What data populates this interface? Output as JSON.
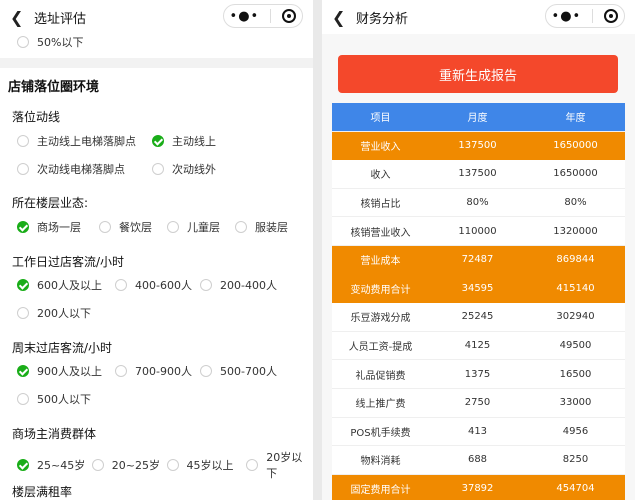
{
  "left": {
    "title": "选址评估",
    "top_option": "50%以下",
    "section_title": "店铺落位圈环境",
    "groups": [
      {
        "label": "落位动线",
        "options": [
          "主动线上电梯落脚点",
          "主动线上",
          "次动线电梯落脚点",
          "次动线外"
        ],
        "selected": 1
      },
      {
        "label": "所在楼层业态:",
        "options": [
          "商场一层",
          "餐饮层",
          "儿童层",
          "服装层"
        ],
        "selected": 0
      },
      {
        "label": "工作日过店客流/小时",
        "options": [
          "600人及以上",
          "400-600人",
          "200-400人",
          "200人以下"
        ],
        "selected": 0
      },
      {
        "label": "周末过店客流/小时",
        "options": [
          "900人及以上",
          "700-900人",
          "500-700人",
          "500人以下"
        ],
        "selected": 0
      },
      {
        "label": "商场主消费群体",
        "options": [
          "25~45岁",
          "20~25岁",
          "45岁以上",
          "20岁以下"
        ],
        "selected": 0
      },
      {
        "label": "楼层满租率"
      }
    ]
  },
  "right": {
    "title": "财务分析",
    "button_label": "重新生成报告",
    "table": {
      "headers": [
        "项目",
        "月度",
        "年度"
      ],
      "rows": [
        {
          "item": "营业收入",
          "month": "137500",
          "year": "1650000",
          "highlight": true
        },
        {
          "item": "收入",
          "month": "137500",
          "year": "1650000",
          "highlight": false
        },
        {
          "item": "核销占比",
          "month": "80%",
          "year": "80%",
          "highlight": false
        },
        {
          "item": "核销营业收入",
          "month": "110000",
          "year": "1320000",
          "highlight": false
        },
        {
          "item": "营业成本",
          "month": "72487",
          "year": "869844",
          "highlight": true
        },
        {
          "item": "变动费用合计",
          "month": "34595",
          "year": "415140",
          "highlight": true
        },
        {
          "item": "乐豆游戏分成",
          "month": "25245",
          "year": "302940",
          "highlight": false
        },
        {
          "item": "人员工资-提成",
          "month": "4125",
          "year": "49500",
          "highlight": false
        },
        {
          "item": "礼品促销费",
          "month": "1375",
          "year": "16500",
          "highlight": false
        },
        {
          "item": "线上推广费",
          "month": "2750",
          "year": "33000",
          "highlight": false
        },
        {
          "item": "POS机手续费",
          "month": "413",
          "year": "4956",
          "highlight": false
        },
        {
          "item": "物料消耗",
          "month": "688",
          "year": "8250",
          "highlight": false
        },
        {
          "item": "固定费用合计",
          "month": "37892",
          "year": "454704",
          "highlight": true
        }
      ]
    }
  },
  "icons": {
    "back": "chevron-left-icon",
    "more": "more-dots-icon",
    "close": "target-icon"
  },
  "colors": {
    "accent_green": "#1aad19",
    "button_red": "#f4482b",
    "table_head_blue": "#3f86e8",
    "highlight_orange": "#f08a00"
  }
}
